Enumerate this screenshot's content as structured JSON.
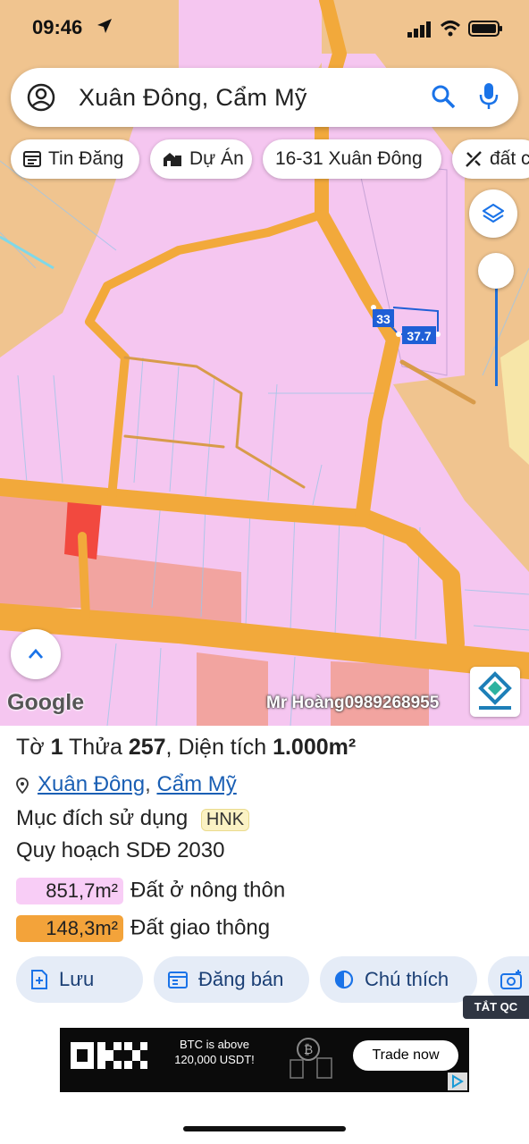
{
  "status_bar": {
    "time": "09:46"
  },
  "search": {
    "query": "Xuân Đông, Cẩm Mỹ"
  },
  "chips": [
    {
      "label": "Tin Đăng",
      "icon": "listing-icon"
    },
    {
      "label": "Dự Án",
      "icon": "building-icon"
    },
    {
      "label": "16-31 Xuân Đông",
      "icon": ""
    },
    {
      "label": "đất c",
      "icon": "ruler-icon"
    }
  ],
  "map": {
    "measurements": [
      "33",
      "37.7"
    ],
    "attribution": "Google",
    "watermark": "Mr Hoàng0989268955",
    "colors": {
      "residential": "#f5c6f0",
      "road": "#f2a93b",
      "agri": "#f0c48f",
      "commercial": "#f2a4a0",
      "selected_parcel": "#f2493f"
    }
  },
  "parcel": {
    "title_prefix": "Tờ",
    "sheet": "1",
    "parcel_label": "Thửa",
    "parcel_no": "257",
    "area_label": "Diện tích",
    "area": "1.000m²",
    "location": {
      "commune": "Xuân Đông",
      "separator": ",",
      "district": "Cẩm Mỹ"
    },
    "usage_label": "Mục đích sử dụng",
    "usage_code": "HNK",
    "plan_label": "Quy hoạch SDĐ 2030",
    "plan_items": [
      {
        "area": "851,7m²",
        "label": "Đất ở nông thôn",
        "color": "#f8cdf6"
      },
      {
        "area": "148,3m²",
        "label": "Đất giao thông",
        "color": "#f3a33a"
      }
    ]
  },
  "actions": [
    {
      "label": "Lưu",
      "icon": "save-icon"
    },
    {
      "label": "Đăng bán",
      "icon": "post-icon"
    },
    {
      "label": "Chú thích",
      "icon": "legend-icon"
    },
    {
      "label": "",
      "icon": "camera-icon"
    }
  ],
  "ad": {
    "close_label": "TẮT QC",
    "brand": "OKX",
    "text": "BTC is above 120,000 USDT!",
    "cta": "Trade now"
  }
}
